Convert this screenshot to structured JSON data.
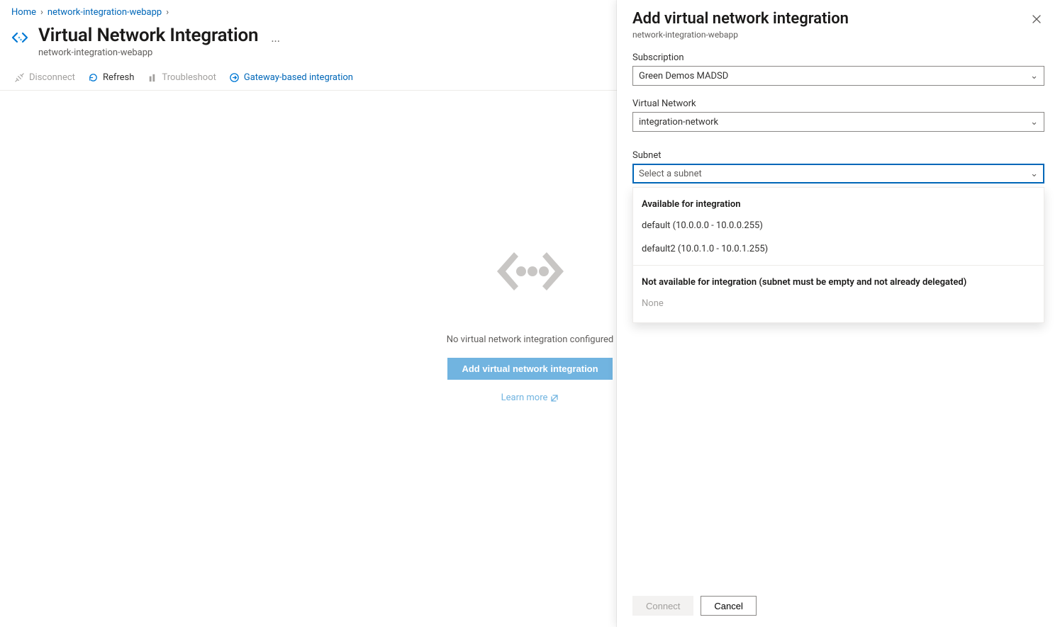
{
  "breadcrumb": {
    "home": "Home",
    "resource": "network-integration-webapp"
  },
  "header": {
    "title": "Virtual Network Integration",
    "subtitle": "network-integration-webapp"
  },
  "toolbar": {
    "disconnect": "Disconnect",
    "refresh": "Refresh",
    "troubleshoot": "Troubleshoot",
    "gateway": "Gateway-based integration"
  },
  "empty": {
    "message": "No virtual network integration configured",
    "add_button": "Add virtual network integration",
    "learn_more": "Learn more"
  },
  "panel": {
    "title": "Add virtual network integration",
    "subtitle": "network-integration-webapp",
    "subscription_label": "Subscription",
    "subscription_value": "Green Demos MADSD",
    "vnet_label": "Virtual Network",
    "vnet_value": "integration-network",
    "subnet_label": "Subnet",
    "subnet_placeholder": "Select a subnet",
    "dropdown": {
      "available_header": "Available for integration",
      "options": [
        "default (10.0.0.0 - 10.0.0.255)",
        "default2 (10.0.1.0 - 10.0.1.255)"
      ],
      "not_available_header": "Not available for integration (subnet must be empty and not already delegated)",
      "none": "None"
    },
    "connect": "Connect",
    "cancel": "Cancel"
  }
}
